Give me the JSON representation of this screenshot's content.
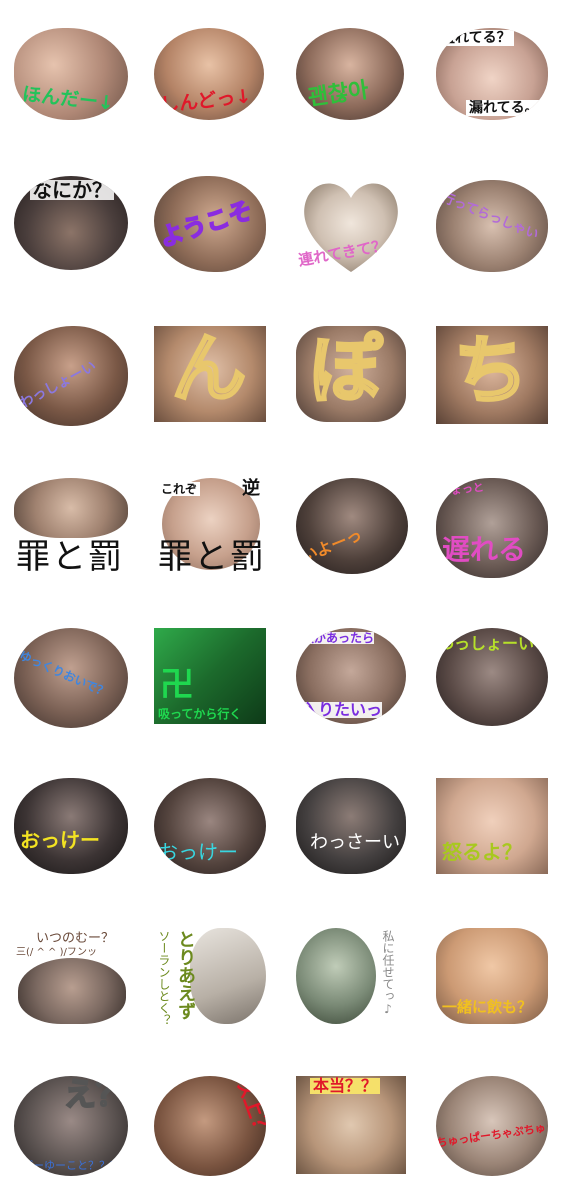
{
  "title": "sticker grid",
  "stickers": [
    {
      "caption": "ほんだー↓",
      "color": "#22c35a",
      "bg": "#c8a894"
    },
    {
      "caption": "しんどっ↓",
      "color": "#e0182a",
      "bg": "#c39a7e"
    },
    {
      "caption": "괜찮아",
      "color": "#2fbf3a",
      "bg": "#9a7866"
    },
    {
      "caption": "盛れてる？",
      "caption2": "漏れてる。",
      "color": "#111111",
      "bg": "#d9b8a8"
    },
    {
      "caption": "なにか？",
      "color": "#111111",
      "bg": "#3f3a3a"
    },
    {
      "caption": "ようこそ",
      "color": "#8a2ce0",
      "bg": "#9c7b66"
    },
    {
      "caption": "連れてきて？",
      "color": "#e067c8",
      "bg": "#d6cbbe"
    },
    {
      "caption": "行ってらっしゃい",
      "color": "#b26bd8",
      "bg": "#c0aa98"
    },
    {
      "caption": "わっしょーい",
      "color": "#8b78e0",
      "bg": "#8c6a58"
    },
    {
      "caption": "ん",
      "color": "#e8c76c",
      "bg": "#c29a7c"
    },
    {
      "caption": "ぽ",
      "color": "#e8c76c",
      "bg": "#a88a78"
    },
    {
      "caption": "ち",
      "color": "#e8c76c",
      "bg": "#b6907a"
    },
    {
      "caption": "罪と罰",
      "color": "#111111",
      "bg": "#b79d88"
    },
    {
      "caption": "罪と罰",
      "caption2": "これぞ",
      "caption3": "逆",
      "color": "#111111",
      "bg": "#d2b8a6"
    },
    {
      "caption": "いよーっ",
      "color": "#f08a2a",
      "bg": "#3a3230"
    },
    {
      "caption": "遅れる",
      "caption2": "ちょっと",
      "color": "#e14cc3",
      "bg": "#5a4a46"
    },
    {
      "caption": "ゆっくりおいで？",
      "color": "#3f86e0",
      "bg": "#6b5a52"
    },
    {
      "caption": "卍",
      "caption2": "吸ってから行く",
      "color": "#1fd84f",
      "bg": "#2a8a3a"
    },
    {
      "caption": "入りたいっ",
      "caption2": "穴があったら",
      "color": "#7a2de0",
      "bg": "#6b5448"
    },
    {
      "caption": "わっしょーい",
      "color": "#b6e02a",
      "bg": "#4c4040"
    },
    {
      "caption": "おっけー",
      "color": "#f3e322",
      "bg": "#2c2a2a"
    },
    {
      "caption": "おっけー",
      "color": "#38d6e0",
      "bg": "#3c3430"
    },
    {
      "caption": "わっさーい",
      "color": "#ffffff",
      "bg": "#3a3636"
    },
    {
      "caption": "怒るよ？",
      "color": "#a8c81f",
      "bg": "#d8b49e"
    },
    {
      "caption": "いつのむー？",
      "caption2": "三(/ ^ ^ )/フンッ",
      "color": "#6a4a3a",
      "bg": "#7a6860"
    },
    {
      "caption": "とりあえず",
      "caption2": "ソーランしとく？",
      "color": "#6c8a1e",
      "bg": "#d0ccc4"
    },
    {
      "caption": "私に任せてっ♪",
      "color": "#8a8a8a",
      "bg": "#6e7a6a"
    },
    {
      "caption": "一緒に飲も？",
      "color": "#f0c020",
      "bg": "#d49a6e"
    },
    {
      "caption": "え？",
      "caption2": "どーゆーこと？？？",
      "color": "#3a70d8",
      "bg": "#5a5452"
    },
    {
      "caption": "以上？",
      "color": "#e0182a",
      "bg": "#6a4838"
    },
    {
      "caption": "本当？？",
      "color": "#e0182a",
      "bg": "#b08a6e"
    },
    {
      "caption": "ちゅっぱーちゃぷちゅ",
      "color": "#e0182a",
      "bg": "#9a8476"
    }
  ]
}
